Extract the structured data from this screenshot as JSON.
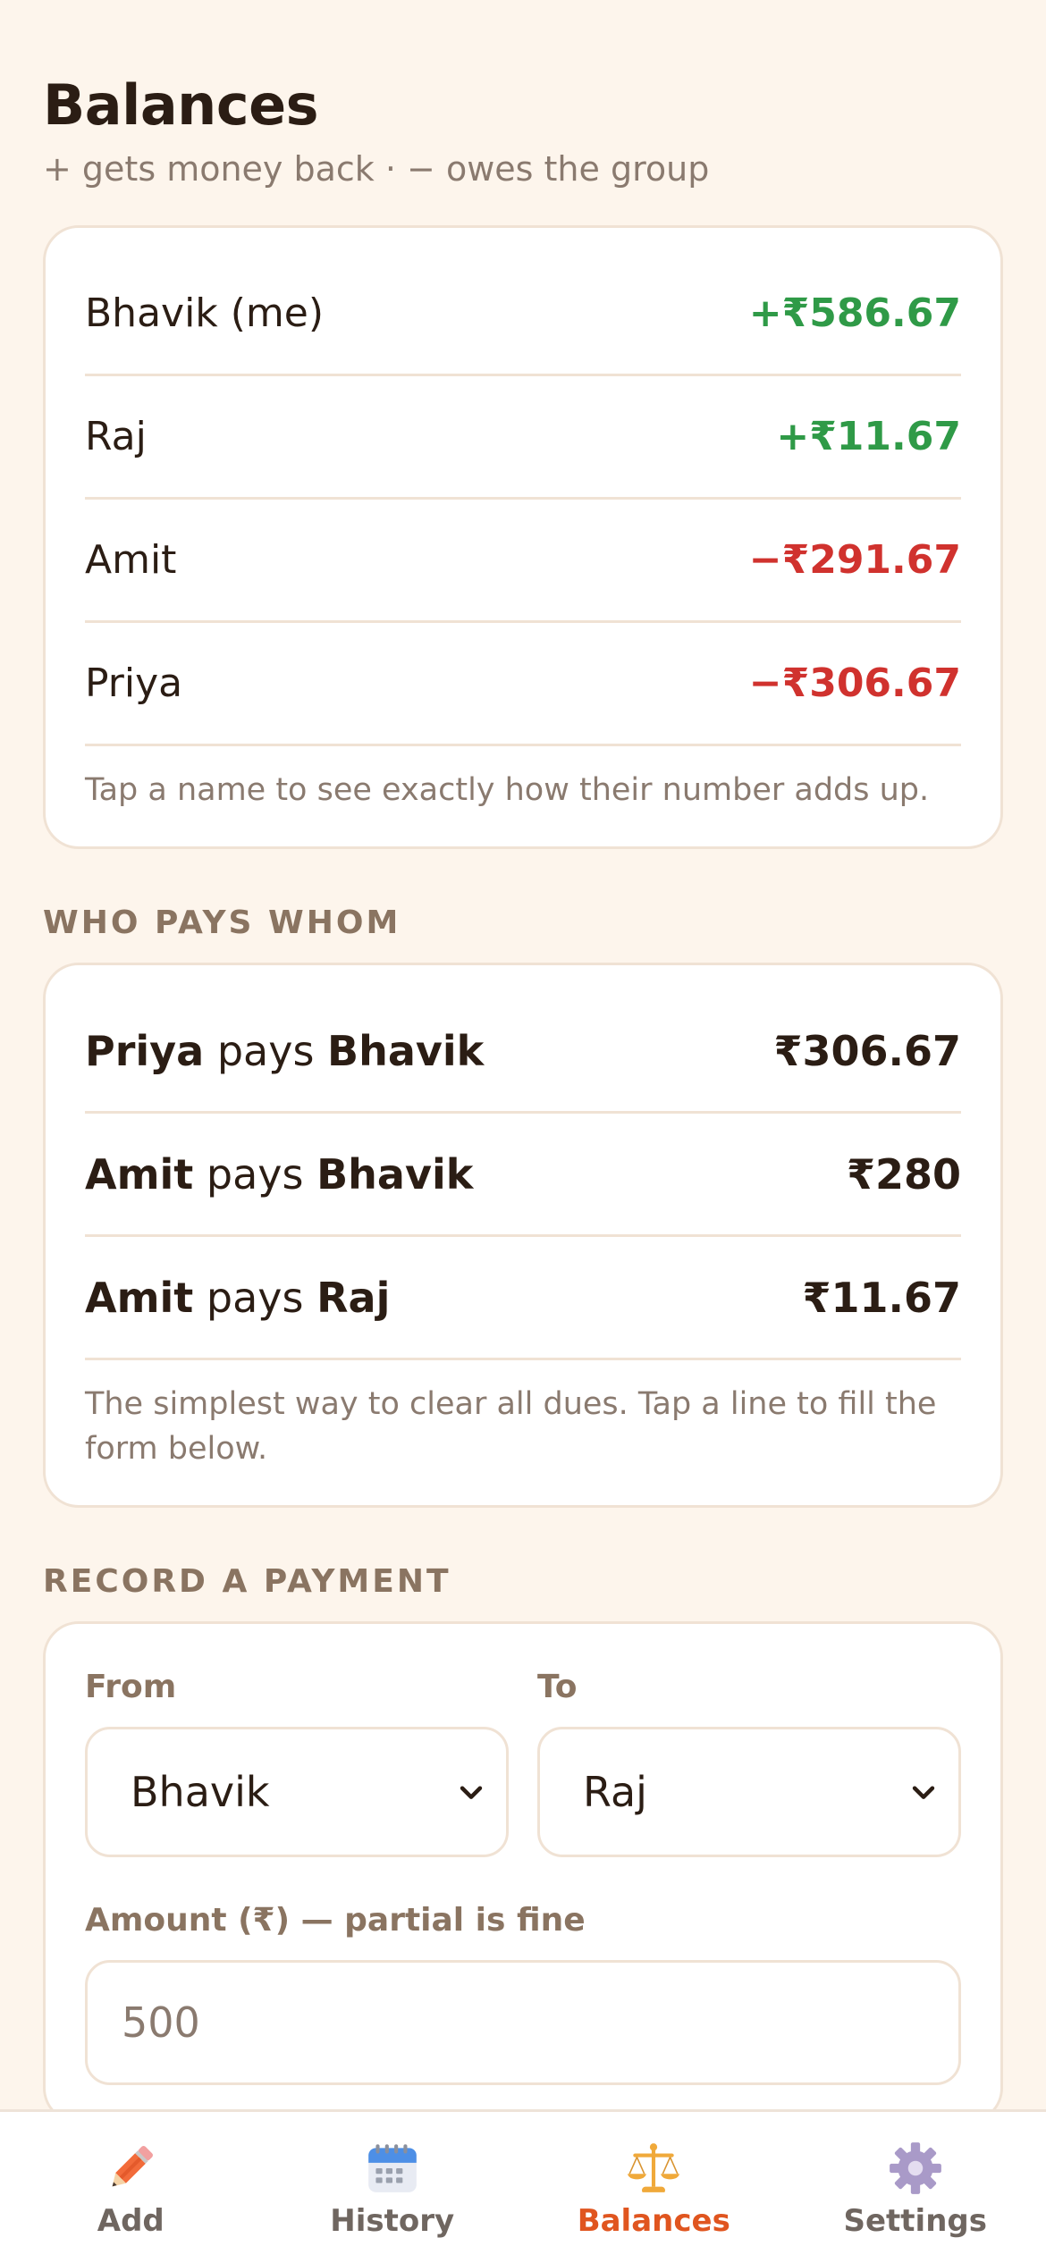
{
  "header": {
    "title": "Balances",
    "subtitle": "+ gets money back · − owes the group"
  },
  "balances": {
    "rows": [
      {
        "name": "Bhavik (me)",
        "amount": "+₹586.67",
        "sign": "pos"
      },
      {
        "name": "Raj",
        "amount": "+₹11.67",
        "sign": "pos"
      },
      {
        "name": "Amit",
        "amount": "−₹291.67",
        "sign": "neg"
      },
      {
        "name": "Priya",
        "amount": "−₹306.67",
        "sign": "neg"
      }
    ],
    "note": "Tap a name to see exactly how their number adds up."
  },
  "settle": {
    "label": "WHO PAYS WHOM",
    "connector": "pays",
    "rows": [
      {
        "from": "Priya",
        "to": "Bhavik",
        "amount": "₹306.67"
      },
      {
        "from": "Amit",
        "to": "Bhavik",
        "amount": "₹280"
      },
      {
        "from": "Amit",
        "to": "Raj",
        "amount": "₹11.67"
      }
    ],
    "note": "The simplest way to clear all dues. Tap a line to fill the form below."
  },
  "payment": {
    "label": "RECORD A PAYMENT",
    "from_label": "From",
    "from_value": "Bhavik",
    "to_label": "To",
    "to_value": "Raj",
    "amount_label": "Amount (₹) — partial is fine",
    "amount_value": "500"
  },
  "tabs": [
    {
      "label": "Add",
      "icon": "pencil-icon"
    },
    {
      "label": "History",
      "icon": "calendar-icon"
    },
    {
      "label": "Balances",
      "icon": "scales-icon",
      "active": true
    },
    {
      "label": "Settings",
      "icon": "gear-icon"
    }
  ],
  "colors": {
    "positive": "#2f9a47",
    "negative": "#d0322e",
    "accent": "#e0551f",
    "background": "#fdf5ec"
  }
}
